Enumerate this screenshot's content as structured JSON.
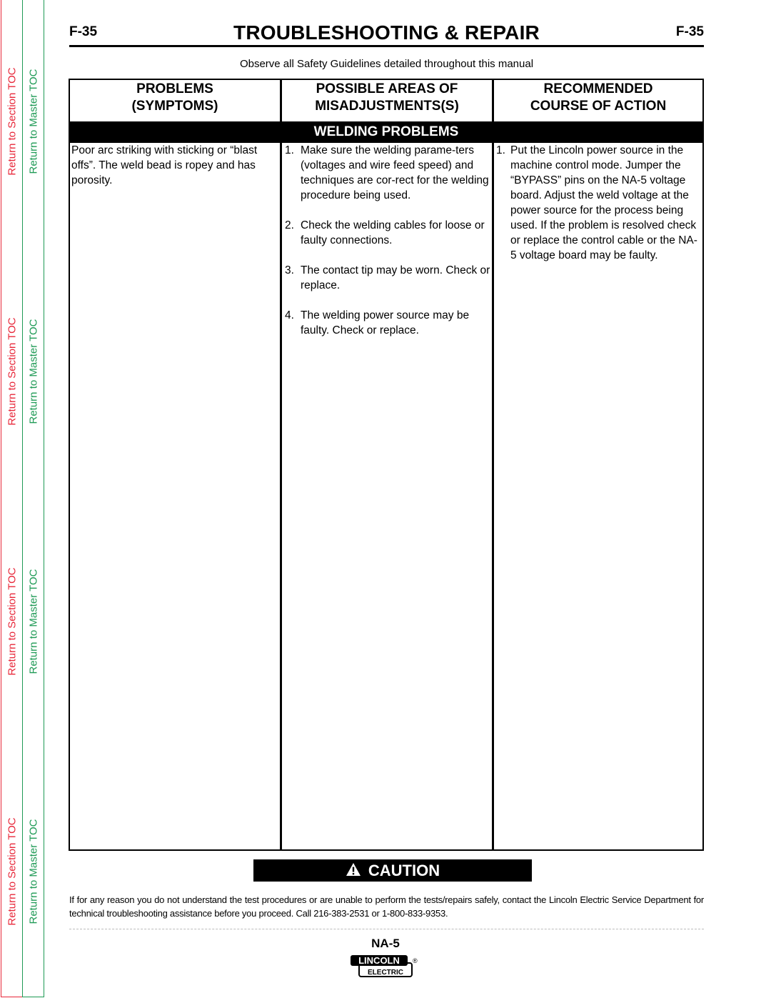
{
  "sidebar": {
    "section_toc_label": "Return to Section TOC",
    "master_toc_label": "Return to Master TOC",
    "colors": {
      "section": "#e8283a",
      "master": "#1e9a55"
    }
  },
  "header": {
    "page_number_left": "F-35",
    "title": "TROUBLESHOOTING & REPAIR",
    "page_number_right": "F-35",
    "safety_note": "Observe all Safety Guidelines detailed throughout this manual"
  },
  "table": {
    "columns": [
      {
        "line1": "PROBLEMS",
        "line2": "(SYMPTOMS)"
      },
      {
        "line1": "POSSIBLE AREAS OF",
        "line2": "MISADJUSTMENTS(S)"
      },
      {
        "line1": "RECOMMENDED",
        "line2": "COURSE OF ACTION"
      }
    ],
    "section_band": "WELDING PROBLEMS",
    "rows": [
      {
        "problem": "Poor arc striking with sticking or “blast offs”.  The weld bead is ropey and has porosity.",
        "possible_areas": [
          {
            "num": "1.",
            "text": "Make sure the welding parame-ters (voltages and wire feed speed) and techniques are cor-rect for the welding procedure being used."
          },
          {
            "num": "2.",
            "text": "Check the welding cables for loose or faulty connections."
          },
          {
            "num": "3.",
            "text": "The contact tip may be worn. Check or replace."
          },
          {
            "num": "4.",
            "text": "The welding power source may be faulty.  Check or replace."
          }
        ],
        "recommended": [
          {
            "num": "1.",
            "text": "Put the Lincoln power source in the machine control mode. Jumper the “BYPASS” pins on the NA-5 voltage board.  Adjust the weld voltage at the power source for the process being used.  If the problem is resolved check or replace the control cable or the NA-5 voltage board may be faulty."
          }
        ]
      }
    ]
  },
  "caution": {
    "icon": "warning-triangle-icon",
    "label": "CAUTION",
    "text": "If for any reason you do not understand the test procedures or are unable to perform the tests/repairs safely, contact the Lincoln Electric Service Department for technical troubleshooting assistance before you proceed. Call 216-383-2531 or 1-800-833-9353."
  },
  "footer": {
    "model": "NA-5",
    "logo_top": "LINCOLN",
    "logo_bottom": "ELECTRIC",
    "registered_mark": "®"
  }
}
